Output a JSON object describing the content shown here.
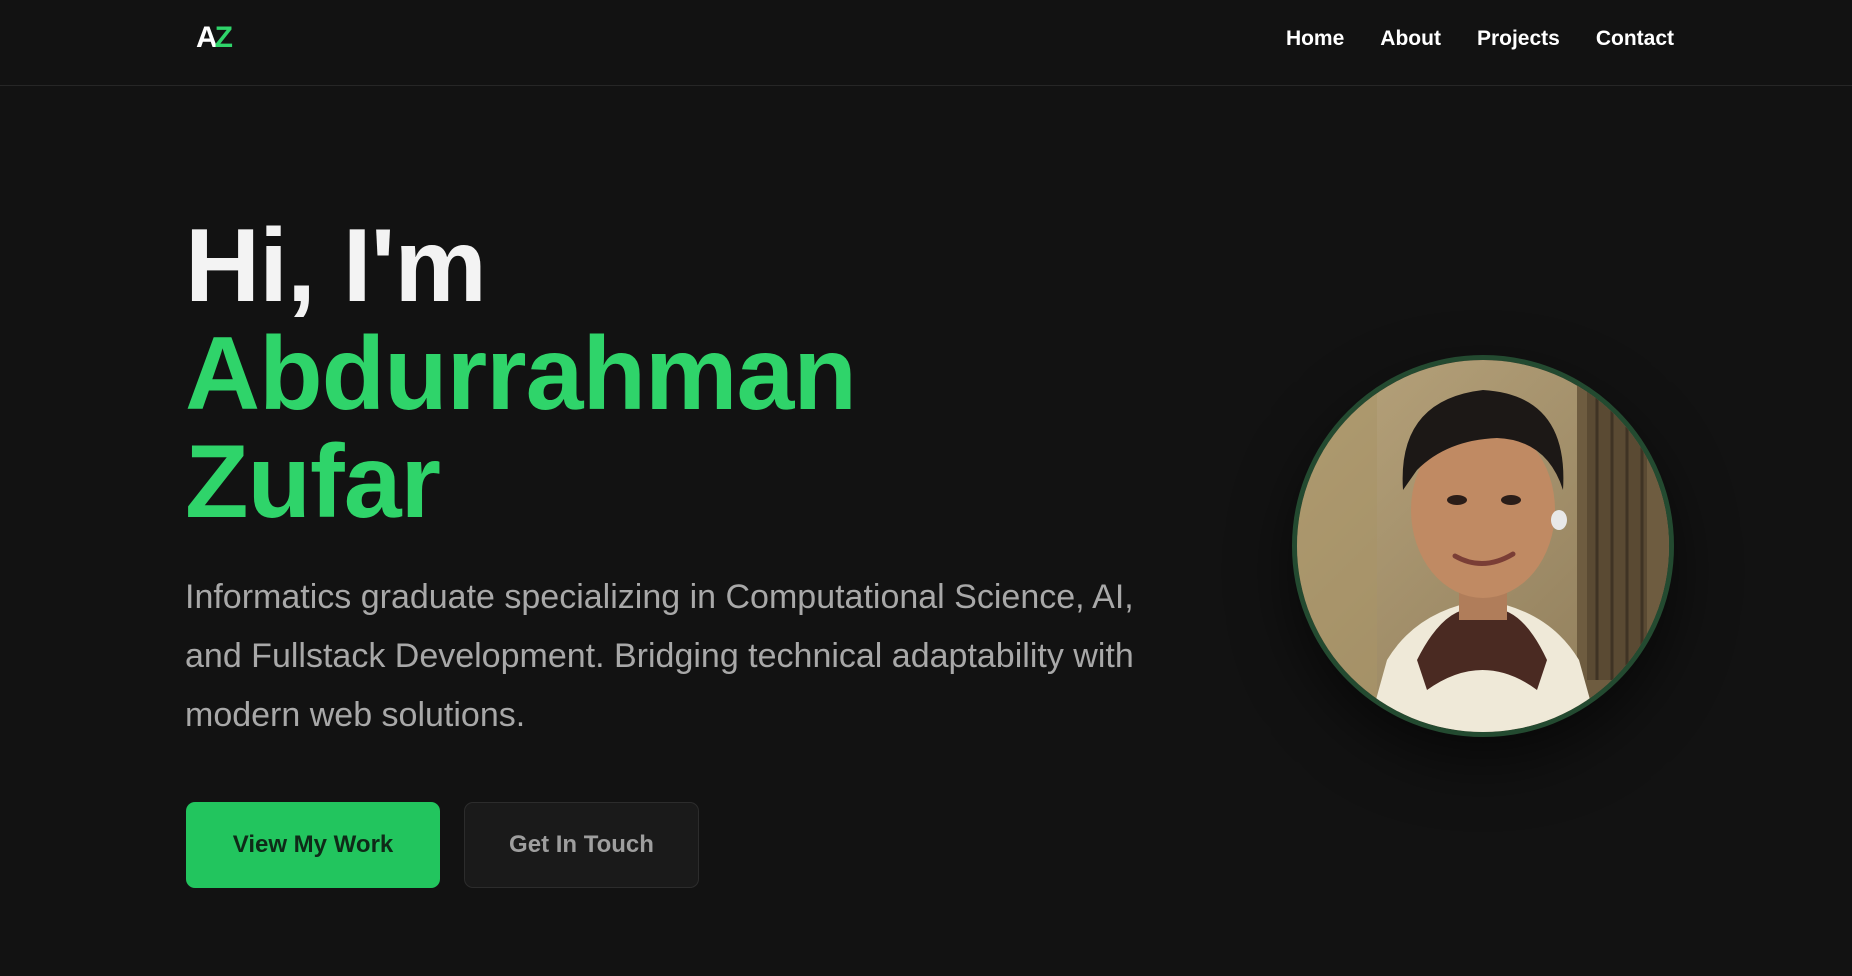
{
  "nav": {
    "logo_a": "A",
    "logo_z": "Z",
    "links": [
      "Home",
      "About",
      "Projects",
      "Contact"
    ]
  },
  "hero": {
    "greeting": "Hi, I'm",
    "first_name": "Abdurrahman",
    "last_name": "Zufar",
    "subtitle": "Informatics graduate specializing in Computational Science, AI, and Fullstack Development. Bridging technical adaptability with modern web solutions.",
    "primary_cta": "View My Work",
    "secondary_cta": "Get In Touch"
  },
  "colors": {
    "background": "#121212",
    "accent": "#2fd46a",
    "button_primary": "#22c55e"
  }
}
